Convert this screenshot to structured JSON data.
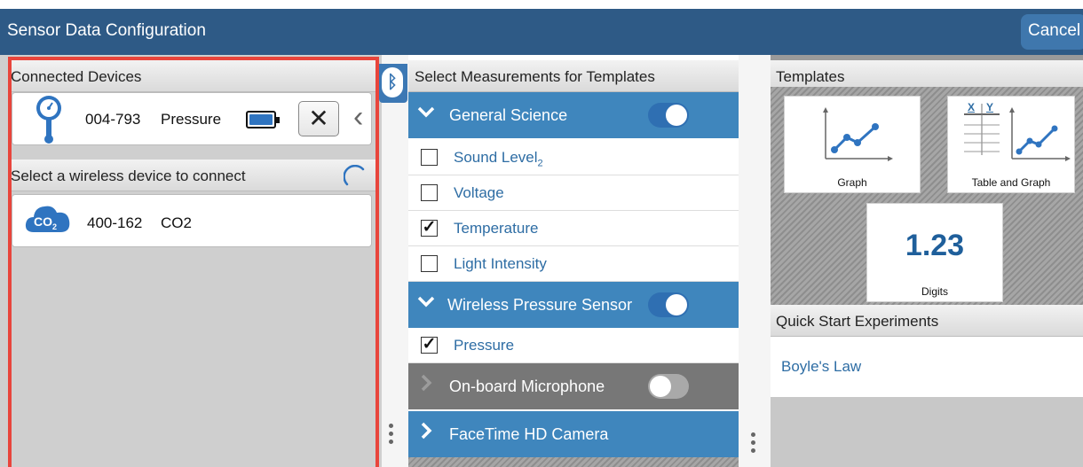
{
  "header": {
    "title": "Sensor Data Configuration",
    "cancel_label": "Cancel"
  },
  "connected": {
    "heading": "Connected Devices",
    "device": {
      "id": "004-793",
      "name": "Pressure",
      "icon": "pressure-gauge-icon"
    }
  },
  "wireless": {
    "heading": "Select a wireless device to connect",
    "devices": [
      {
        "id": "400-162",
        "name": "CO2",
        "icon": "co2-cloud-icon",
        "badge": "CO",
        "badge_sub": "2"
      }
    ]
  },
  "measurements": {
    "heading": "Select Measurements for Templates",
    "groups": [
      {
        "label": "General Science",
        "enabled": true,
        "items": [
          {
            "label": "Sound Level",
            "subscript": "2",
            "checked": false
          },
          {
            "label": "Voltage",
            "checked": false
          },
          {
            "label": "Temperature",
            "checked": true
          },
          {
            "label": "Light Intensity",
            "checked": false
          }
        ]
      },
      {
        "label": "Wireless Pressure Sensor",
        "enabled": true,
        "items": [
          {
            "label": "Pressure",
            "checked": true
          }
        ]
      },
      {
        "label": "On-board Microphone",
        "enabled": false
      },
      {
        "label": "FaceTime HD Camera"
      }
    ]
  },
  "templates": {
    "heading": "Templates",
    "items": [
      {
        "label": "Graph"
      },
      {
        "label": "Table and Graph",
        "header_x": "X",
        "header_y": "Y"
      },
      {
        "label": "Digits",
        "preview": "1.23"
      }
    ]
  },
  "quickstart": {
    "heading": "Quick Start Experiments",
    "items": [
      "Boyle's Law"
    ]
  },
  "colors": {
    "header": "#2e5a86",
    "accent": "#3f86bd",
    "highlight": "#e8453c",
    "link": "#2e6da4"
  }
}
